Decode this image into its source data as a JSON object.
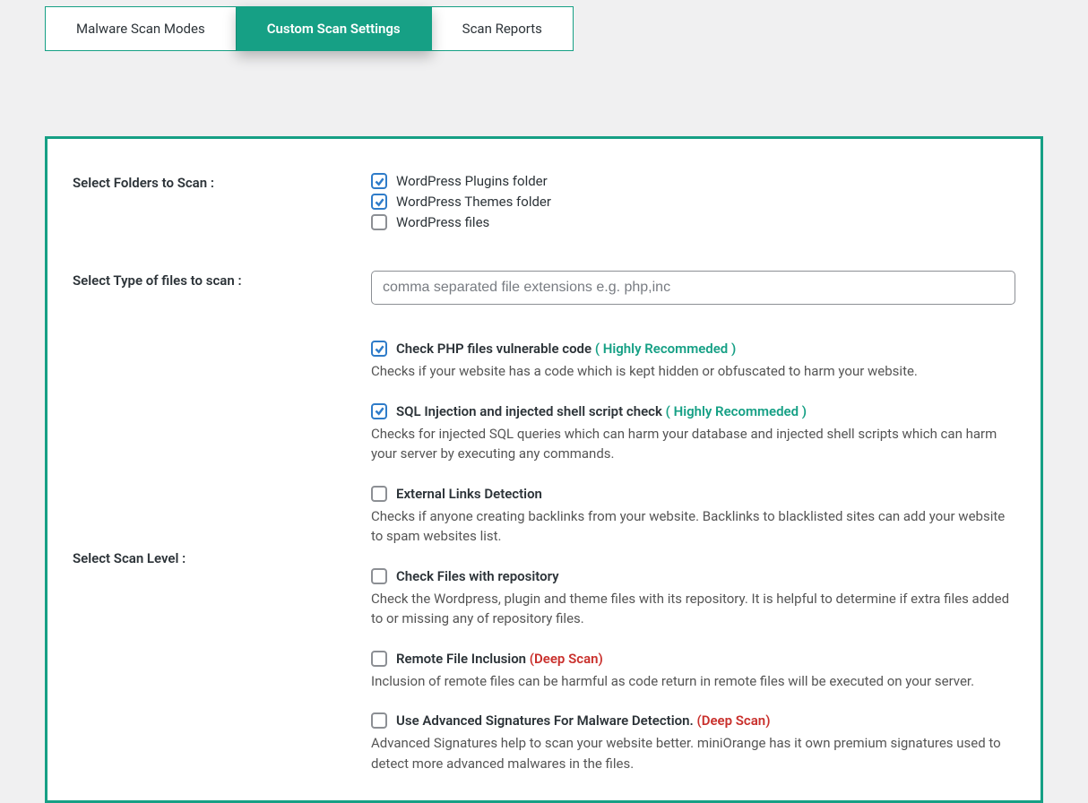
{
  "tabs": {
    "t0": "Malware Scan Modes",
    "t1": "Custom Scan Settings",
    "t2": "Scan Reports"
  },
  "labels": {
    "folders": "Select Folders to Scan :",
    "filetypes": "Select Type of files to scan :",
    "scanlevel": "Select Scan Level :"
  },
  "folders": {
    "plugins": "WordPress Plugins folder",
    "themes": "WordPress Themes folder",
    "files": "WordPress files"
  },
  "filetypes": {
    "placeholder": "comma separated file extensions e.g. php,inc"
  },
  "scan": {
    "php": {
      "title": "Check PHP files vulnerable code",
      "hint": "( Highly Recommeded )",
      "desc": "Checks if your website has a code which is kept hidden or obfuscated to harm your website."
    },
    "sql": {
      "title": "SQL Injection and injected shell script check",
      "hint": "( Highly Recommeded )",
      "desc": "Checks for injected SQL queries which can harm your database and injected shell scripts which can harm your server by executing any commands."
    },
    "ext": {
      "title": "External Links Detection",
      "desc": "Checks if anyone creating backlinks from your website. Backlinks to blacklisted sites can add your website to spam websites list."
    },
    "repo": {
      "title": "Check Files with repository",
      "desc": "Check the Wordpress, plugin and theme files with its repository. It is helpful to determine if extra files added to or missing any of repository files."
    },
    "rfi": {
      "title": "Remote File Inclusion",
      "hint": "(Deep Scan)",
      "desc": "Inclusion of remote files can be harmful as code return in remote files will be executed on your server."
    },
    "adv": {
      "title": "Use Advanced Signatures For Malware Detection.",
      "hint": "(Deep Scan)",
      "desc": "Advanced Signatures help to scan your website better. miniOrange has it own premium signatures used to detect more advanced malwares in the files."
    }
  }
}
